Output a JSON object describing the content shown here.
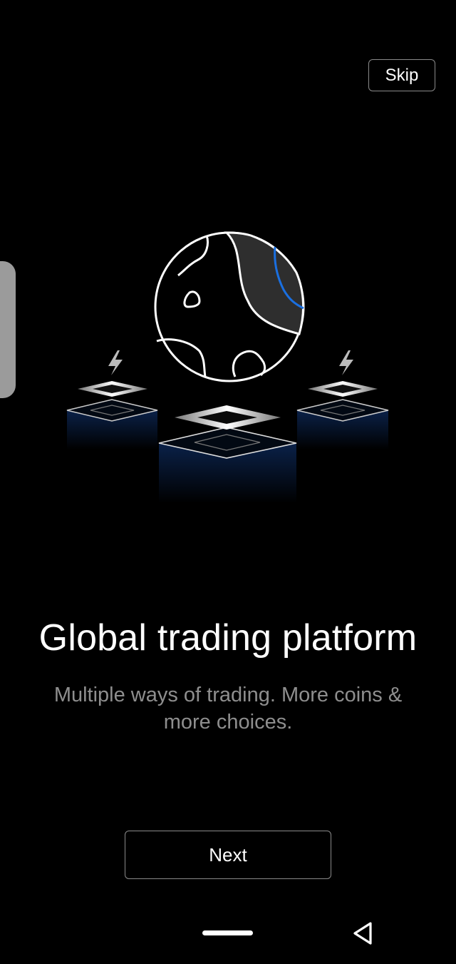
{
  "header": {
    "skip_label": "Skip"
  },
  "onboarding": {
    "title": "Global trading platform",
    "subtitle": "Multiple ways of trading. More coins & more choices.",
    "next_label": "Next",
    "illustration": "globe-over-platforms-illustration"
  },
  "colors": {
    "background": "#000000",
    "accent_blue": "#1a6fe0",
    "subtitle_gray": "#8e8e8e"
  },
  "system_nav": {
    "home_indicator": "home-indicator",
    "back_icon": "back-triangle-icon"
  }
}
